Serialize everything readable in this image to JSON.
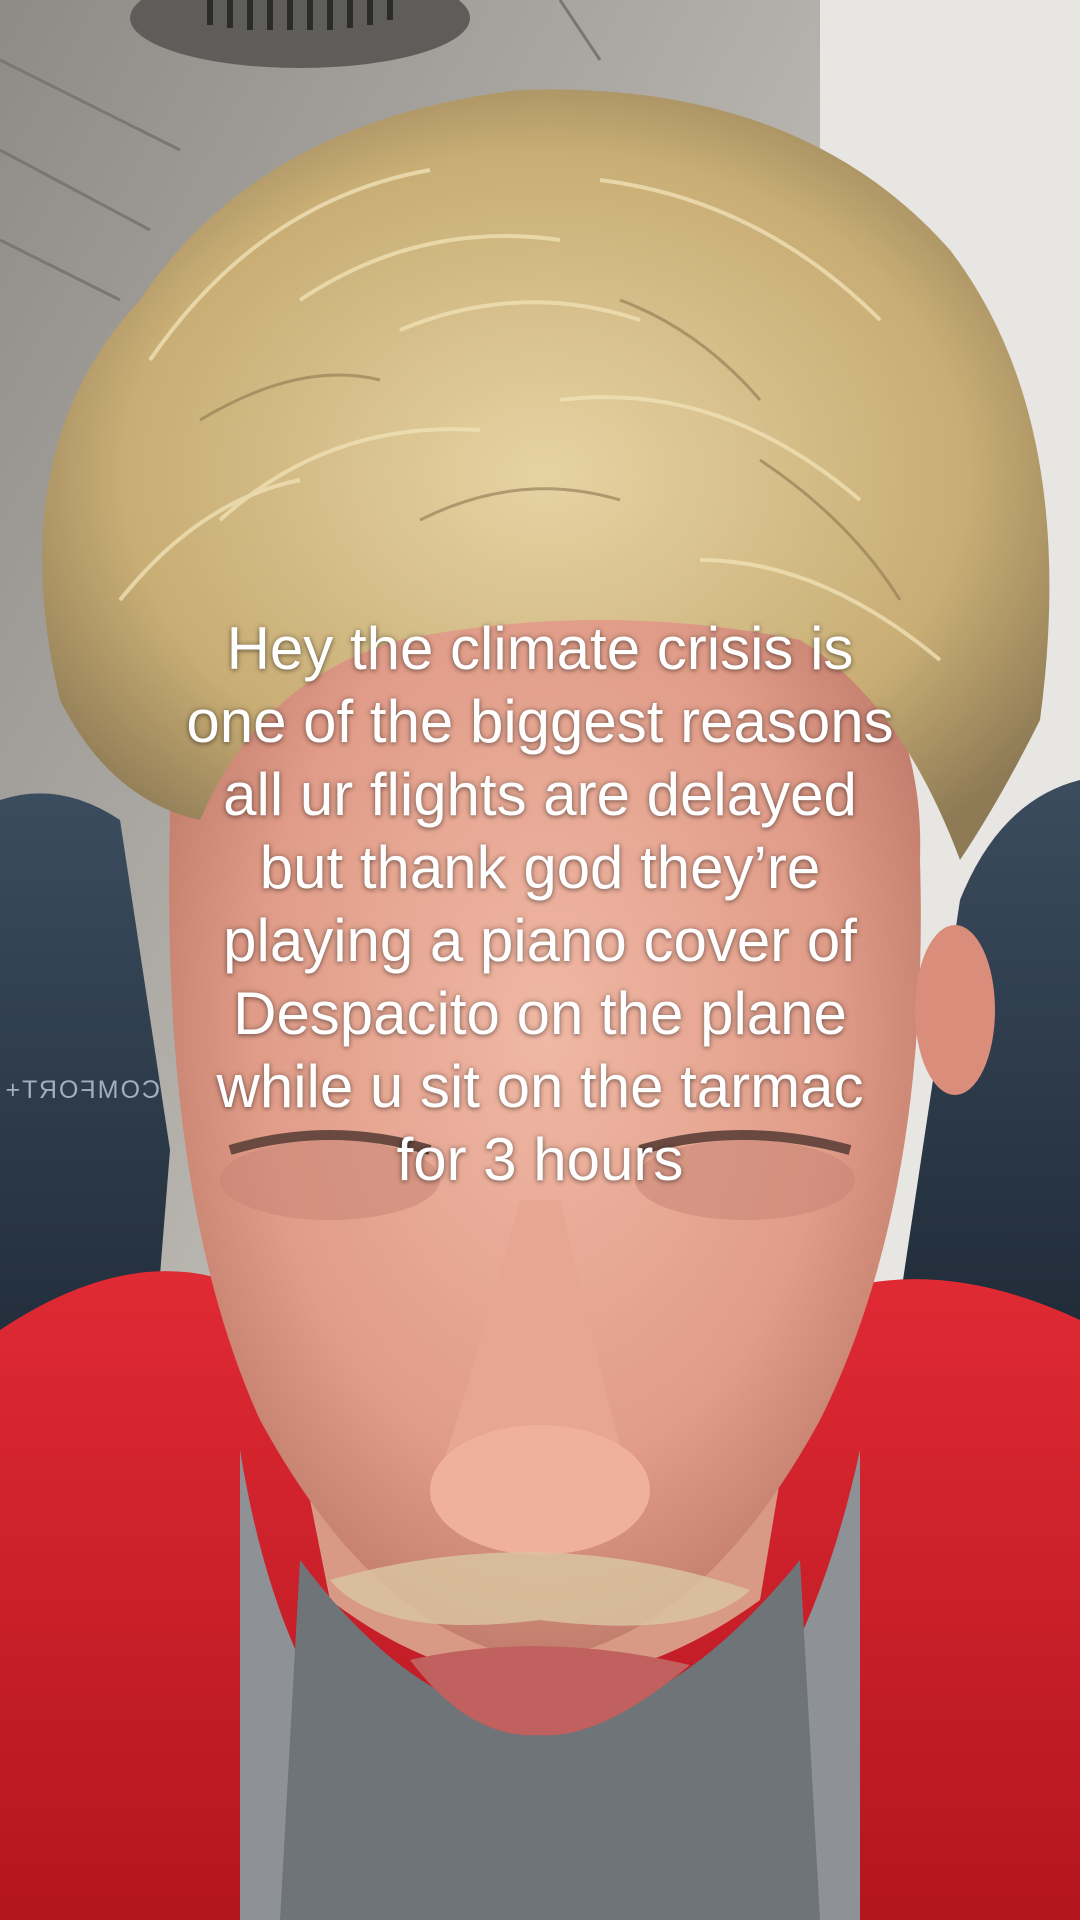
{
  "caption": {
    "lines": [
      "Hey the climate crisis is",
      "one of the biggest reasons",
      "all ur flights are delayed",
      "but thank god they’re",
      "playing a piano cover of",
      "Despacito on the plane",
      "while u sit on the tarmac",
      "for 3 hours"
    ]
  },
  "seat_label": "COMFORT+",
  "colors": {
    "caption_text": "#ffffff",
    "hoodie": "#d81e2a",
    "hair": "#d8c08a",
    "skin": "#e3a892",
    "seat": "#2e3d4d"
  }
}
